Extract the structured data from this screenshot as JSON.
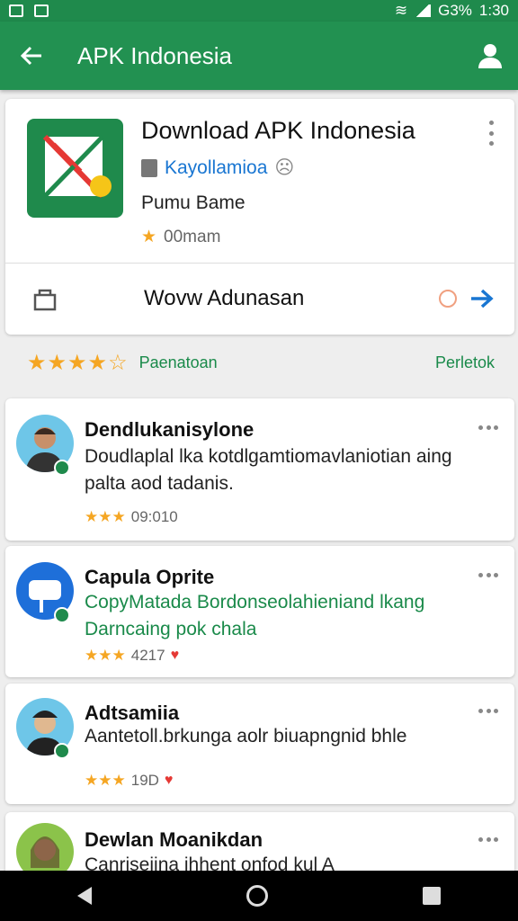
{
  "status_bar": {
    "battery": "G3%",
    "time": "1:30"
  },
  "app_bar": {
    "title": "APK Indonesia",
    "icons": [
      "back-arrow-icon",
      "profile-icon"
    ]
  },
  "app_card": {
    "name": "Download APK Indonesia",
    "developer": "Kayollamioa",
    "category": "Pumu Bame",
    "rating": "00mam",
    "store_label": "Wovw Adunasan"
  },
  "summary": {
    "label": "Paenatoan",
    "right": "Perletok"
  },
  "reviews": [
    {
      "name": "Dendlukanisylone",
      "text": "Doudlaplal lka kotdlgamtiomavlaniotian aing palta aod tadanis.",
      "meta": "09:010"
    },
    {
      "name": "Capula Oprite",
      "text": "CopyMatada Bordonseolahieniand lkang Darncaing pok chala",
      "meta": "4217"
    },
    {
      "name": "Adtsamiia",
      "text": "Aantetoll.brkunga aolr biuapngnid bhle",
      "meta": "19D"
    },
    {
      "name": "Dewlan Moanikdan",
      "text": "Canrisejina ihhent onfod kul A",
      "meta": ""
    }
  ],
  "colors": {
    "primary": "#229151",
    "accent": "#1976d2",
    "star": "#f5a623",
    "link": "#1a8a4a"
  }
}
